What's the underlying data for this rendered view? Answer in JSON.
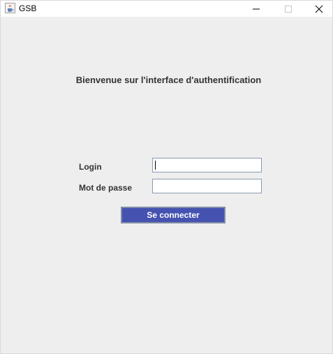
{
  "window": {
    "title": "GSB",
    "icon": "java-cup-icon",
    "controls": [
      "minimize-icon",
      "maximize-icon",
      "close-icon"
    ]
  },
  "main": {
    "welcome": "Bienvenue sur l'interface d'authentification",
    "login_label": "Login",
    "login_value": "",
    "password_label": "Mot de passe",
    "password_value": "",
    "connect_label": "Se connecter"
  },
  "colors": {
    "background": "#eeeeee",
    "button": "#4552b0",
    "button_text": "#ffffff"
  }
}
